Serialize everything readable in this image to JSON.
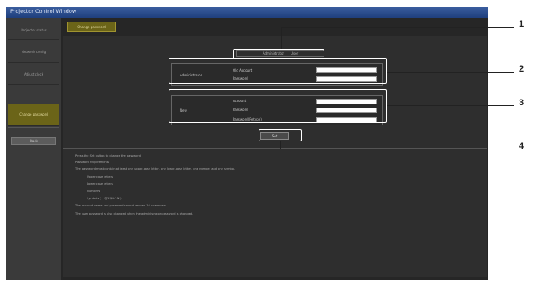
{
  "window": {
    "title": "Projector Control Window"
  },
  "sidebar": {
    "items": [
      {
        "label": "Projector status"
      },
      {
        "label": "Network config"
      },
      {
        "label": "Adjust clock"
      },
      {
        "label": "Change password"
      }
    ],
    "button_label": "Back"
  },
  "tab_active": "Change password",
  "subtab": {
    "left": "Administrator",
    "right": "User"
  },
  "group_admin": {
    "label": "Administrator",
    "rows": [
      "Old Account",
      "Password"
    ]
  },
  "group_new": {
    "label": "New",
    "rows": [
      "Account",
      "Password",
      "Password(Retype)"
    ]
  },
  "set_button": "Set",
  "notes": [
    "Press the Set button to change the password.",
    "Password requirements",
    "The password must contain at least one upper-case letter, one lower-case letter, one number and one symbol.",
    "Upper-case letters",
    "Lower-case letters",
    "Numbers",
    "Symbols (~!@#$%^&*)",
    "The account name and password cannot exceed 16 characters.",
    "The user password is also changed when the administrator password is changed."
  ],
  "callouts": [
    "1",
    "2",
    "3",
    "4"
  ]
}
